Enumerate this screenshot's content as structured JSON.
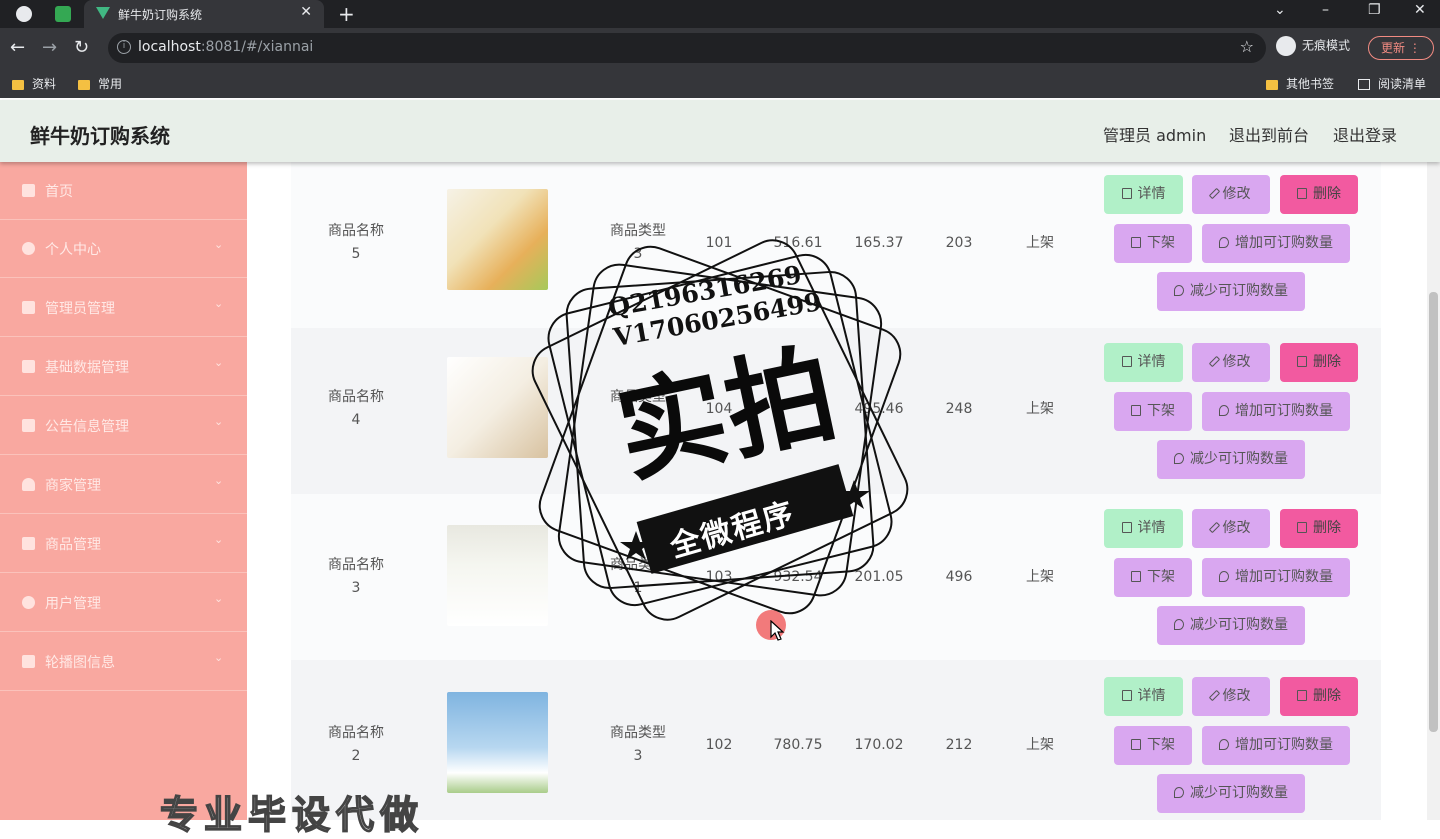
{
  "browser": {
    "tab_title": "鲜牛奶订购系统",
    "url_host": "localhost",
    "url_rest": ":8081/#/xiannai",
    "incognito_label": "无痕模式",
    "update_label": "更新",
    "bookmarks": [
      "资料",
      "常用"
    ],
    "other_bookmarks": "其他书签",
    "reading_list": "阅读清单"
  },
  "header": {
    "title": "鲜牛奶订购系统",
    "admin": "管理员 admin",
    "to_front": "退出到前台",
    "logout": "退出登录"
  },
  "sidebar": {
    "items": [
      {
        "label": "首页",
        "icon": "home-icon"
      },
      {
        "label": "个人中心",
        "icon": "user-icon"
      },
      {
        "label": "管理员管理",
        "icon": "admin-icon"
      },
      {
        "label": "基础数据管理",
        "icon": "data-icon"
      },
      {
        "label": "公告信息管理",
        "icon": "notice-icon"
      },
      {
        "label": "商家管理",
        "icon": "merchant-icon"
      },
      {
        "label": "商品管理",
        "icon": "flag-icon"
      },
      {
        "label": "用户管理",
        "icon": "users-icon"
      },
      {
        "label": "轮播图信息",
        "icon": "list-icon"
      }
    ]
  },
  "table": {
    "rows": [
      {
        "name": "商品名称",
        "num": "5",
        "type": "商品类型",
        "type_num": "3",
        "code": "101",
        "price": "516.61",
        "member_price": "165.37",
        "stock": "203",
        "status": "上架",
        "img": "#e9c27a"
      },
      {
        "name": "商品名称",
        "num": "4",
        "type": "商品类型",
        "type_num": "",
        "code": "104",
        "price": "",
        "member_price": "495.46",
        "stock": "248",
        "status": "上架",
        "img": "#efe6d8"
      },
      {
        "name": "商品名称",
        "num": "3",
        "type": "商品类型",
        "type_num": "1",
        "code": "103",
        "price": "932.54",
        "member_price": "201.05",
        "stock": "496",
        "status": "上架",
        "img": "#d9e4d2"
      },
      {
        "name": "商品名称",
        "num": "2",
        "type": "商品类型",
        "type_num": "3",
        "code": "102",
        "price": "780.75",
        "member_price": "170.02",
        "stock": "212",
        "status": "上架",
        "img": "#9cc6e8"
      }
    ],
    "actions": {
      "detail": "详情",
      "edit": "修改",
      "delete": "删除",
      "off_shelf": "下架",
      "increase": "增加可订购数量",
      "decrease": "减少可订购数量"
    }
  },
  "watermark": {
    "qq": "Q2196316269",
    "wx": "V17060256499",
    "big": "实拍",
    "ribbon": "全微程序",
    "bottom": "专业毕设代做"
  }
}
